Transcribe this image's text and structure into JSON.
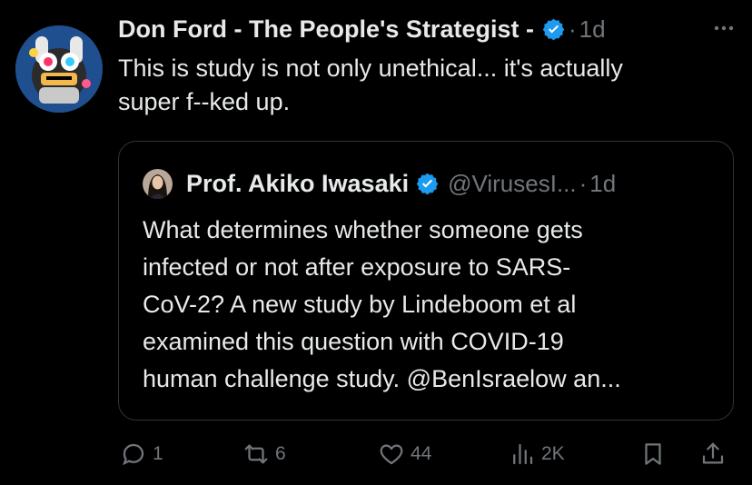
{
  "post": {
    "author_name": "Don Ford - The People's Strategist -",
    "separator": "·",
    "time": "1d",
    "text_lines": [
      "This is study is not only unethical... it's actually",
      "super f--ked up."
    ]
  },
  "quoted": {
    "author_name": "Prof. Akiko Iwasaki",
    "handle": "@VirusesI...",
    "separator": "·",
    "time": "1d",
    "text_lines": [
      "What determines whether someone gets",
      "infected or not after exposure to SARS-",
      "CoV-2? A new study by Lindeboom et al",
      "examined this question with COVID-19",
      "human challenge study. @BenIsraelow an..."
    ]
  },
  "actions": {
    "replies": "1",
    "reposts": "6",
    "likes": "44",
    "views": "2K"
  },
  "icons": {
    "verified": "verified-badge-icon",
    "more": "more-dots-icon",
    "reply": "reply-bubble-icon",
    "repost": "repost-arrows-icon",
    "like": "heart-icon",
    "views": "bar-chart-icon",
    "bookmark": "bookmark-icon",
    "share": "share-upload-icon"
  },
  "colors": {
    "background": "#000000",
    "text": "#e7e9ea",
    "secondary": "#71767b",
    "verified_blue": "#1d9bf0",
    "border": "#2f3336"
  }
}
